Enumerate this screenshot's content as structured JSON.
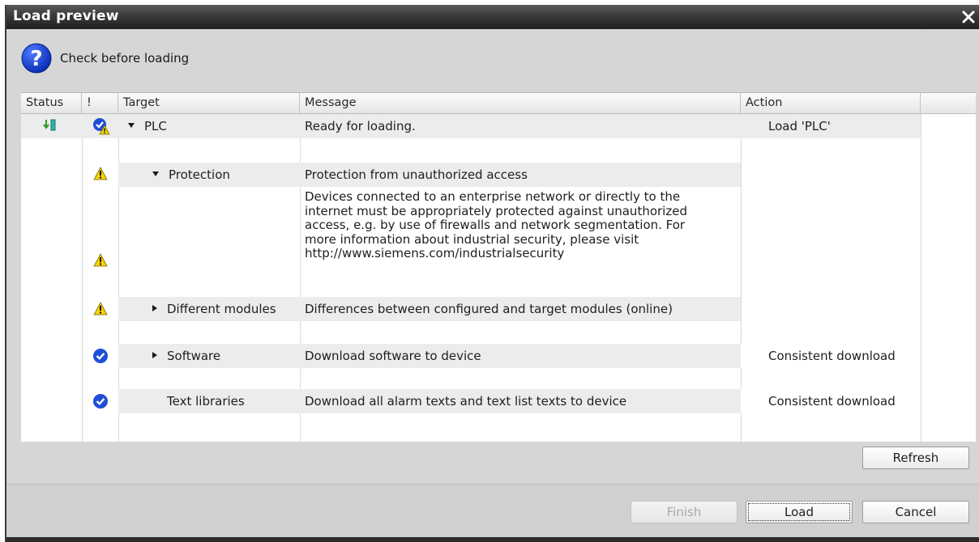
{
  "window": {
    "title": "Load preview",
    "close_glyph": "✕"
  },
  "header": {
    "icon": "question-icon",
    "text": "Check before loading"
  },
  "columns": [
    "Status",
    "!",
    "Target",
    "Message",
    "Action"
  ],
  "rows": [
    {
      "status_icon": "download-status-icon",
      "alert_icon": "check-warning-icon",
      "expander": "down",
      "target": "PLC",
      "message": "Ready for loading.",
      "action": "Load 'PLC'"
    },
    {
      "alert_icon": "warning-icon",
      "expander": "down",
      "target": "Protection",
      "message": "Protection from unauthorized access"
    },
    {
      "alert_icon": "warning-icon",
      "message_lines": [
        "Devices connected to an enterprise network or directly to the",
        "internet must be appropriately protected against unauthorized",
        "access, e.g. by use of firewalls and network segmentation. For",
        "more information about industrial security, please visit",
        "http://www.siemens.com/industrialsecurity"
      ]
    },
    {
      "alert_icon": "warning-icon",
      "expander": "right",
      "target": "Different modules",
      "message": "Differences between configured and target modules (online)"
    },
    {
      "alert_icon": "check-icon",
      "expander": "right",
      "target": "Software",
      "message": "Download software to device",
      "action": "Consistent download"
    },
    {
      "alert_icon": "check-icon",
      "target": "Text libraries",
      "message": "Download all alarm texts and text list texts to device",
      "action": "Consistent download"
    }
  ],
  "buttons": {
    "refresh": "Refresh",
    "finish": "Finish",
    "load": "Load",
    "cancel": "Cancel"
  },
  "colors": {
    "warning_yellow": "#f5d20a",
    "check_blue": "#1f4fd6",
    "title_bar": "#2e2e2e",
    "dialog_bg": "#d6d6d6"
  }
}
